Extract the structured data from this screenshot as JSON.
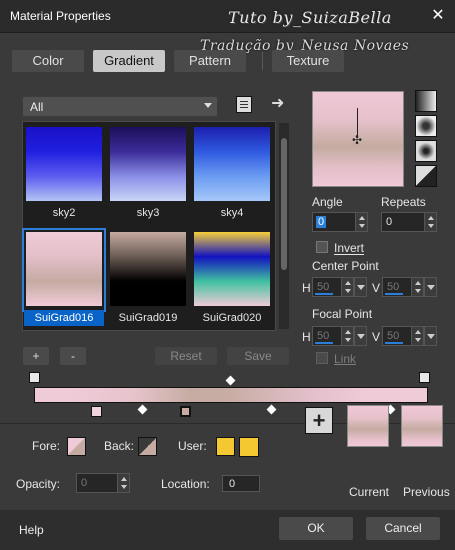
{
  "window": {
    "title": "Material Properties",
    "close_glyph": "✕"
  },
  "watermark": {
    "line1": "Tuto by_SuizaBella",
    "line2": "Tradução by_Neusa Novaes"
  },
  "tabs": [
    "Color",
    "Gradient",
    "Pattern",
    "Texture"
  ],
  "active_tab": "Gradient",
  "category": {
    "selected": "All"
  },
  "gallery": [
    {
      "label": "sky2",
      "colors": [
        "#1a10c8",
        "#2020e0",
        "#5d5cf0",
        "#b4c4f4"
      ]
    },
    {
      "label": "sky3",
      "colors": [
        "#1c0f5a",
        "#3b2c9a",
        "#8a8ee6",
        "#c9d6f6"
      ]
    },
    {
      "label": "sky4",
      "colors": [
        "#1c1fb0",
        "#2f5ae0",
        "#6b9cf2",
        "#a6c8f8"
      ]
    },
    {
      "label": "SuiGrad016",
      "colors": [
        "#efcbd8",
        "#e3bfc8",
        "#c5aba2",
        "#efcbd8"
      ],
      "selected": true
    },
    {
      "label": "SuiGrad019",
      "colors": [
        "#c5aba2",
        "#6b5b55",
        "#000000",
        "#000000"
      ]
    },
    {
      "label": "SuiGrad020",
      "colors": [
        "#f6d03a",
        "#1212c0",
        "#40c0a0",
        "#efcbd8"
      ]
    }
  ],
  "buttons": {
    "plus": "+",
    "minus": "-",
    "reset": "Reset",
    "save": "Save",
    "ok": "OK",
    "cancel": "Cancel",
    "help": "Help"
  },
  "angle": {
    "label": "Angle",
    "value": "0"
  },
  "repeats": {
    "label": "Repeats",
    "value": "0"
  },
  "invert": {
    "label": "Invert",
    "checked": false
  },
  "center_point": {
    "label": "Center Point",
    "h_label": "H",
    "h": "50",
    "v_label": "V",
    "v": "50"
  },
  "focal_point": {
    "label": "Focal Point",
    "h_label": "H",
    "h": "50",
    "v_label": "V",
    "v": "50"
  },
  "link": {
    "label": "Link",
    "checked": false
  },
  "bottom": {
    "fore_label": "Fore:",
    "back_label": "Back:",
    "user_label": "User:",
    "user_color": "#f4c830",
    "opacity_label": "Opacity:",
    "opacity": "0",
    "location_label": "Location:",
    "location": "0",
    "current_label": "Current",
    "previous_label": "Previous"
  }
}
